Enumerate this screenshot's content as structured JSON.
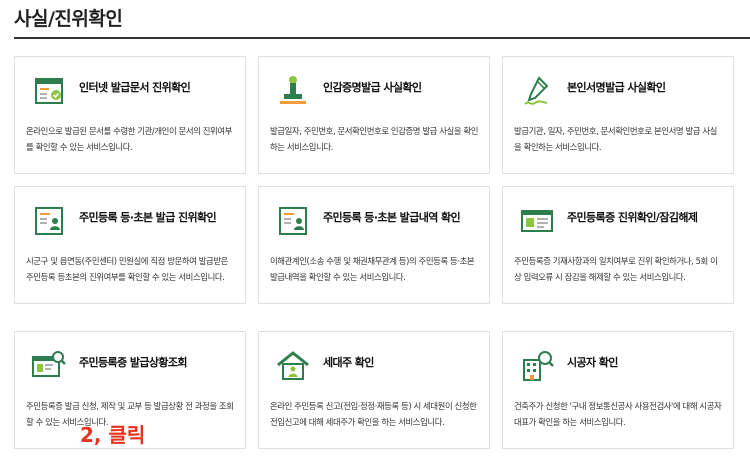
{
  "page": {
    "title": "사실/진위확인"
  },
  "cards": [
    {
      "title": "인터넷 발급문서 진위확인",
      "desc": "온라인으로 발급된 문서를 수령한 기관/개인이 문서의 진위여부를 확인할 수 있는 서비스입니다.",
      "icon": "certificate-check-icon"
    },
    {
      "title": "인감증명발급 사실확인",
      "desc": "발급일자, 주민번호, 문서확인번호로 인감증명 발급 사실을 확인하는 서비스입니다.",
      "icon": "stamp-icon"
    },
    {
      "title": "본인서명발급 사실확인",
      "desc": "발급기관, 일자, 주민번호, 문서확인번호로 본인서명 발급 사실을 확인하는 서비스입니다.",
      "icon": "pen-signature-icon"
    },
    {
      "title": "주민등록 등·초본 발급 진위확인",
      "desc": "시군구 및 읍면동(주민센터) 민원실에 직접 방문하여 발급받은 주민등록 등초본의 진위여부를 확인할 수 있는 서비스입니다.",
      "icon": "resident-document-icon"
    },
    {
      "title": "주민등록 등·초본 발급내역 확인",
      "desc": "이해관계인(소송 수행 및 채권채무관계 등)의 주민등록 등·초본 발급내역을 확인할 수 있는 서비스입니다.",
      "icon": "resident-document-icon"
    },
    {
      "title": "주민등록증 진위확인/잠김해제",
      "desc": "주민등록증 기재사항과의 일치여부로 진위 확인하거나, 5회 이상 입력오류 시 잠김을 해제할 수 있는 서비스입니다.",
      "icon": "id-card-icon"
    },
    {
      "title": "주민등록증 발급상황조회",
      "desc": "주민등록증 발급 신청, 제작 및 교부 등 발급상황 전 과정을 조회할 수 있는 서비스입니다.",
      "icon": "id-card-search-icon"
    },
    {
      "title": "세대주 확인",
      "desc": "온라인 주민등록 신고(전입·정정·재등록 등) 시 세대원이 신청한 전입신고에 대해 세대주가 확인을 하는 서비스입니다.",
      "icon": "house-person-icon"
    },
    {
      "title": "시공자 확인",
      "desc": "건축주가 신청한 '구내 정보통신공사 사용전검사'에 대해 시공자 대표가 확인을 하는 서비스입니다.",
      "icon": "building-search-icon"
    }
  ],
  "annotation": {
    "text": "2, 클릭"
  },
  "colors": {
    "accent_green": "#2e7d4f",
    "light_green": "#8cc63f",
    "orange": "#f29b3a"
  }
}
